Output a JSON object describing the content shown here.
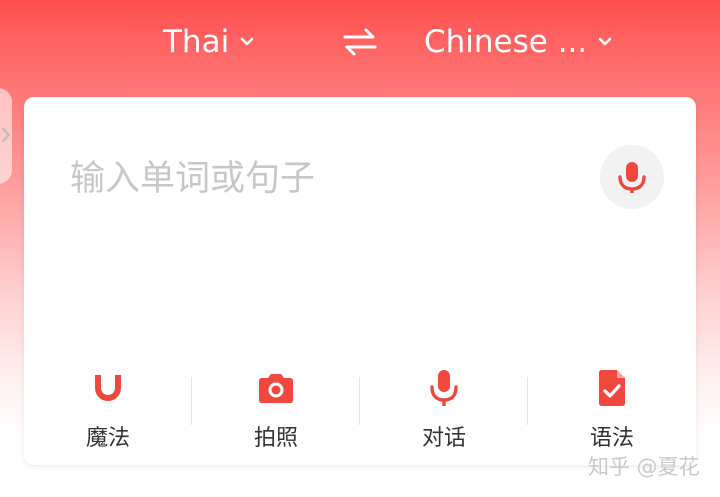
{
  "header": {
    "source_lang": "Thai",
    "target_lang": "Chinese ...",
    "swap_icon": "swap-arrows-icon"
  },
  "input": {
    "placeholder": "输入单词或句子",
    "value": "",
    "mic_icon": "microphone-icon"
  },
  "tools": [
    {
      "label": "魔法",
      "icon": "magnet-icon"
    },
    {
      "label": "拍照",
      "icon": "camera-icon"
    },
    {
      "label": "对话",
      "icon": "microphone-icon"
    },
    {
      "label": "语法",
      "icon": "checked-document-icon"
    }
  ],
  "watermark": "知乎 @夏花",
  "colors": {
    "accent": "#f0483e",
    "header_gradient_top": "#ff4f4f",
    "placeholder": "#c7c7c7",
    "label": "#333333"
  }
}
